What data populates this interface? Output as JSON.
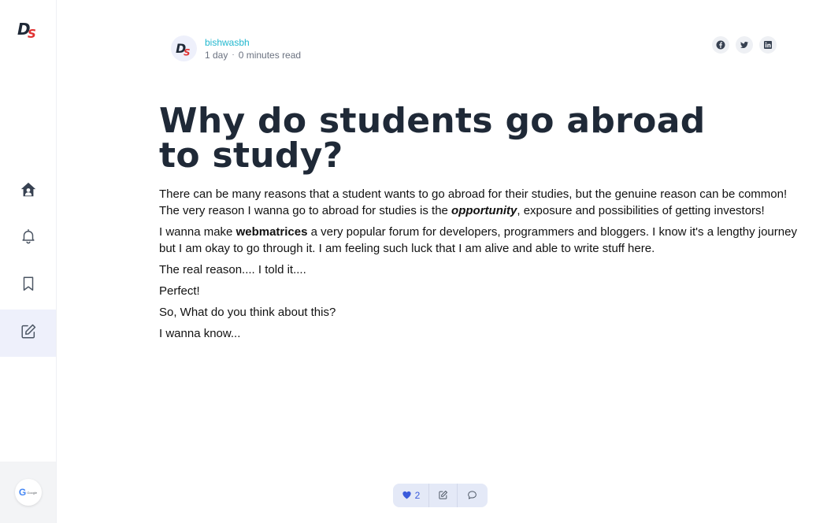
{
  "app": {
    "logo_icon": "ds-logo"
  },
  "sidebar": {
    "items": [
      {
        "name": "home",
        "icon": "home-user-icon"
      },
      {
        "name": "notifications",
        "icon": "bell-icon"
      },
      {
        "name": "bookmarks",
        "icon": "bookmark-icon"
      },
      {
        "name": "write",
        "icon": "edit-icon",
        "active": true
      }
    ],
    "footer": {
      "icon": "google-icon",
      "label": "Google"
    }
  },
  "author": {
    "name": "bishwasbh",
    "age": "1 day",
    "separator": "·",
    "read_time": "0 minutes read"
  },
  "share": {
    "buttons": [
      {
        "name": "facebook",
        "icon": "facebook-icon"
      },
      {
        "name": "twitter",
        "icon": "twitter-icon"
      },
      {
        "name": "linkedin",
        "icon": "linkedin-icon"
      }
    ]
  },
  "article": {
    "title": "Why do students go abroad to study?",
    "p1_text1": "There can be many reasons that a student wants to go abroad for their studies, but the genuine reason can be common! The very reason I wanna go to abroad for studies is the ",
    "p1_emph": "opportunity",
    "p1_text2": ", exposure and possibilities of getting investors!",
    "p2_text1": "I wanna make ",
    "p2_strong": "webmatrices",
    "p2_text2": " a very popular forum for developers, programmers and bloggers. I know it's a lengthy journey but I am okay to go through it. I am feeling such luck that I am alive and able to write stuff here.",
    "p3": "The real reason.... I told it....",
    "p4": "Perfect!",
    "p5": "So, What do you think about this?",
    "p6": "I wanna know..."
  },
  "actions": {
    "like_count": "2",
    "like_icon": "heart-icon",
    "edit_icon": "edit-icon",
    "comment_icon": "comment-icon"
  },
  "colors": {
    "accent": "#3b5bdb",
    "author_name": "#22b8cf",
    "logo_red": "#e03131",
    "logo_dark": "#1f2937"
  }
}
